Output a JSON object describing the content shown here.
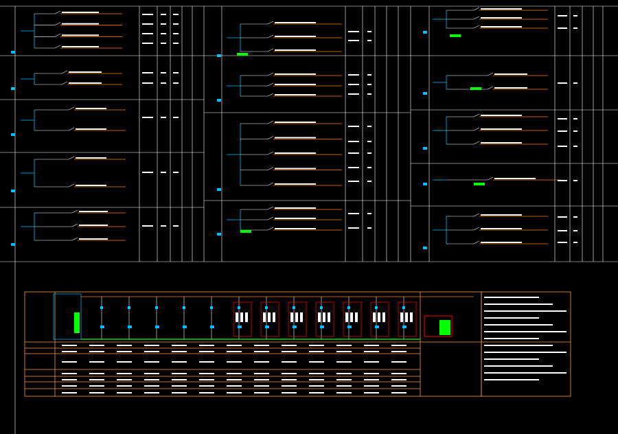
{
  "window": {
    "title": ""
  },
  "colors": {
    "background": "#000000",
    "grid": "#ffffff",
    "bus": "#00bfff",
    "feeder": "#ff8000",
    "device": "#ffffff",
    "highlight_green": "#00ff00",
    "highlight_red": "#ff0000",
    "label_cyan": "#00ffff",
    "panel_frame": "#ff9a40"
  },
  "top_headers": {
    "col1": "",
    "col2": "",
    "col3": "",
    "col4": "",
    "col5": ""
  },
  "panels": [
    {
      "id": "p1",
      "tags": [
        "",
        "",
        "",
        ""
      ]
    },
    {
      "id": "p2",
      "tags": [
        "",
        ""
      ]
    },
    {
      "id": "p3",
      "tags": [
        "",
        "",
        "",
        ""
      ]
    },
    {
      "id": "p4",
      "tags": [
        "",
        "",
        ""
      ]
    },
    {
      "id": "p5",
      "tags": [
        "",
        "",
        ""
      ]
    }
  ],
  "bottom_diagram": {
    "title": "",
    "legend_rows": [
      "",
      "",
      "",
      "",
      "",
      "",
      "",
      ""
    ],
    "notes_title": "",
    "notes": [
      "",
      "",
      "",
      "",
      "",
      "",
      "",
      "",
      "",
      "",
      "",
      "",
      ""
    ]
  }
}
